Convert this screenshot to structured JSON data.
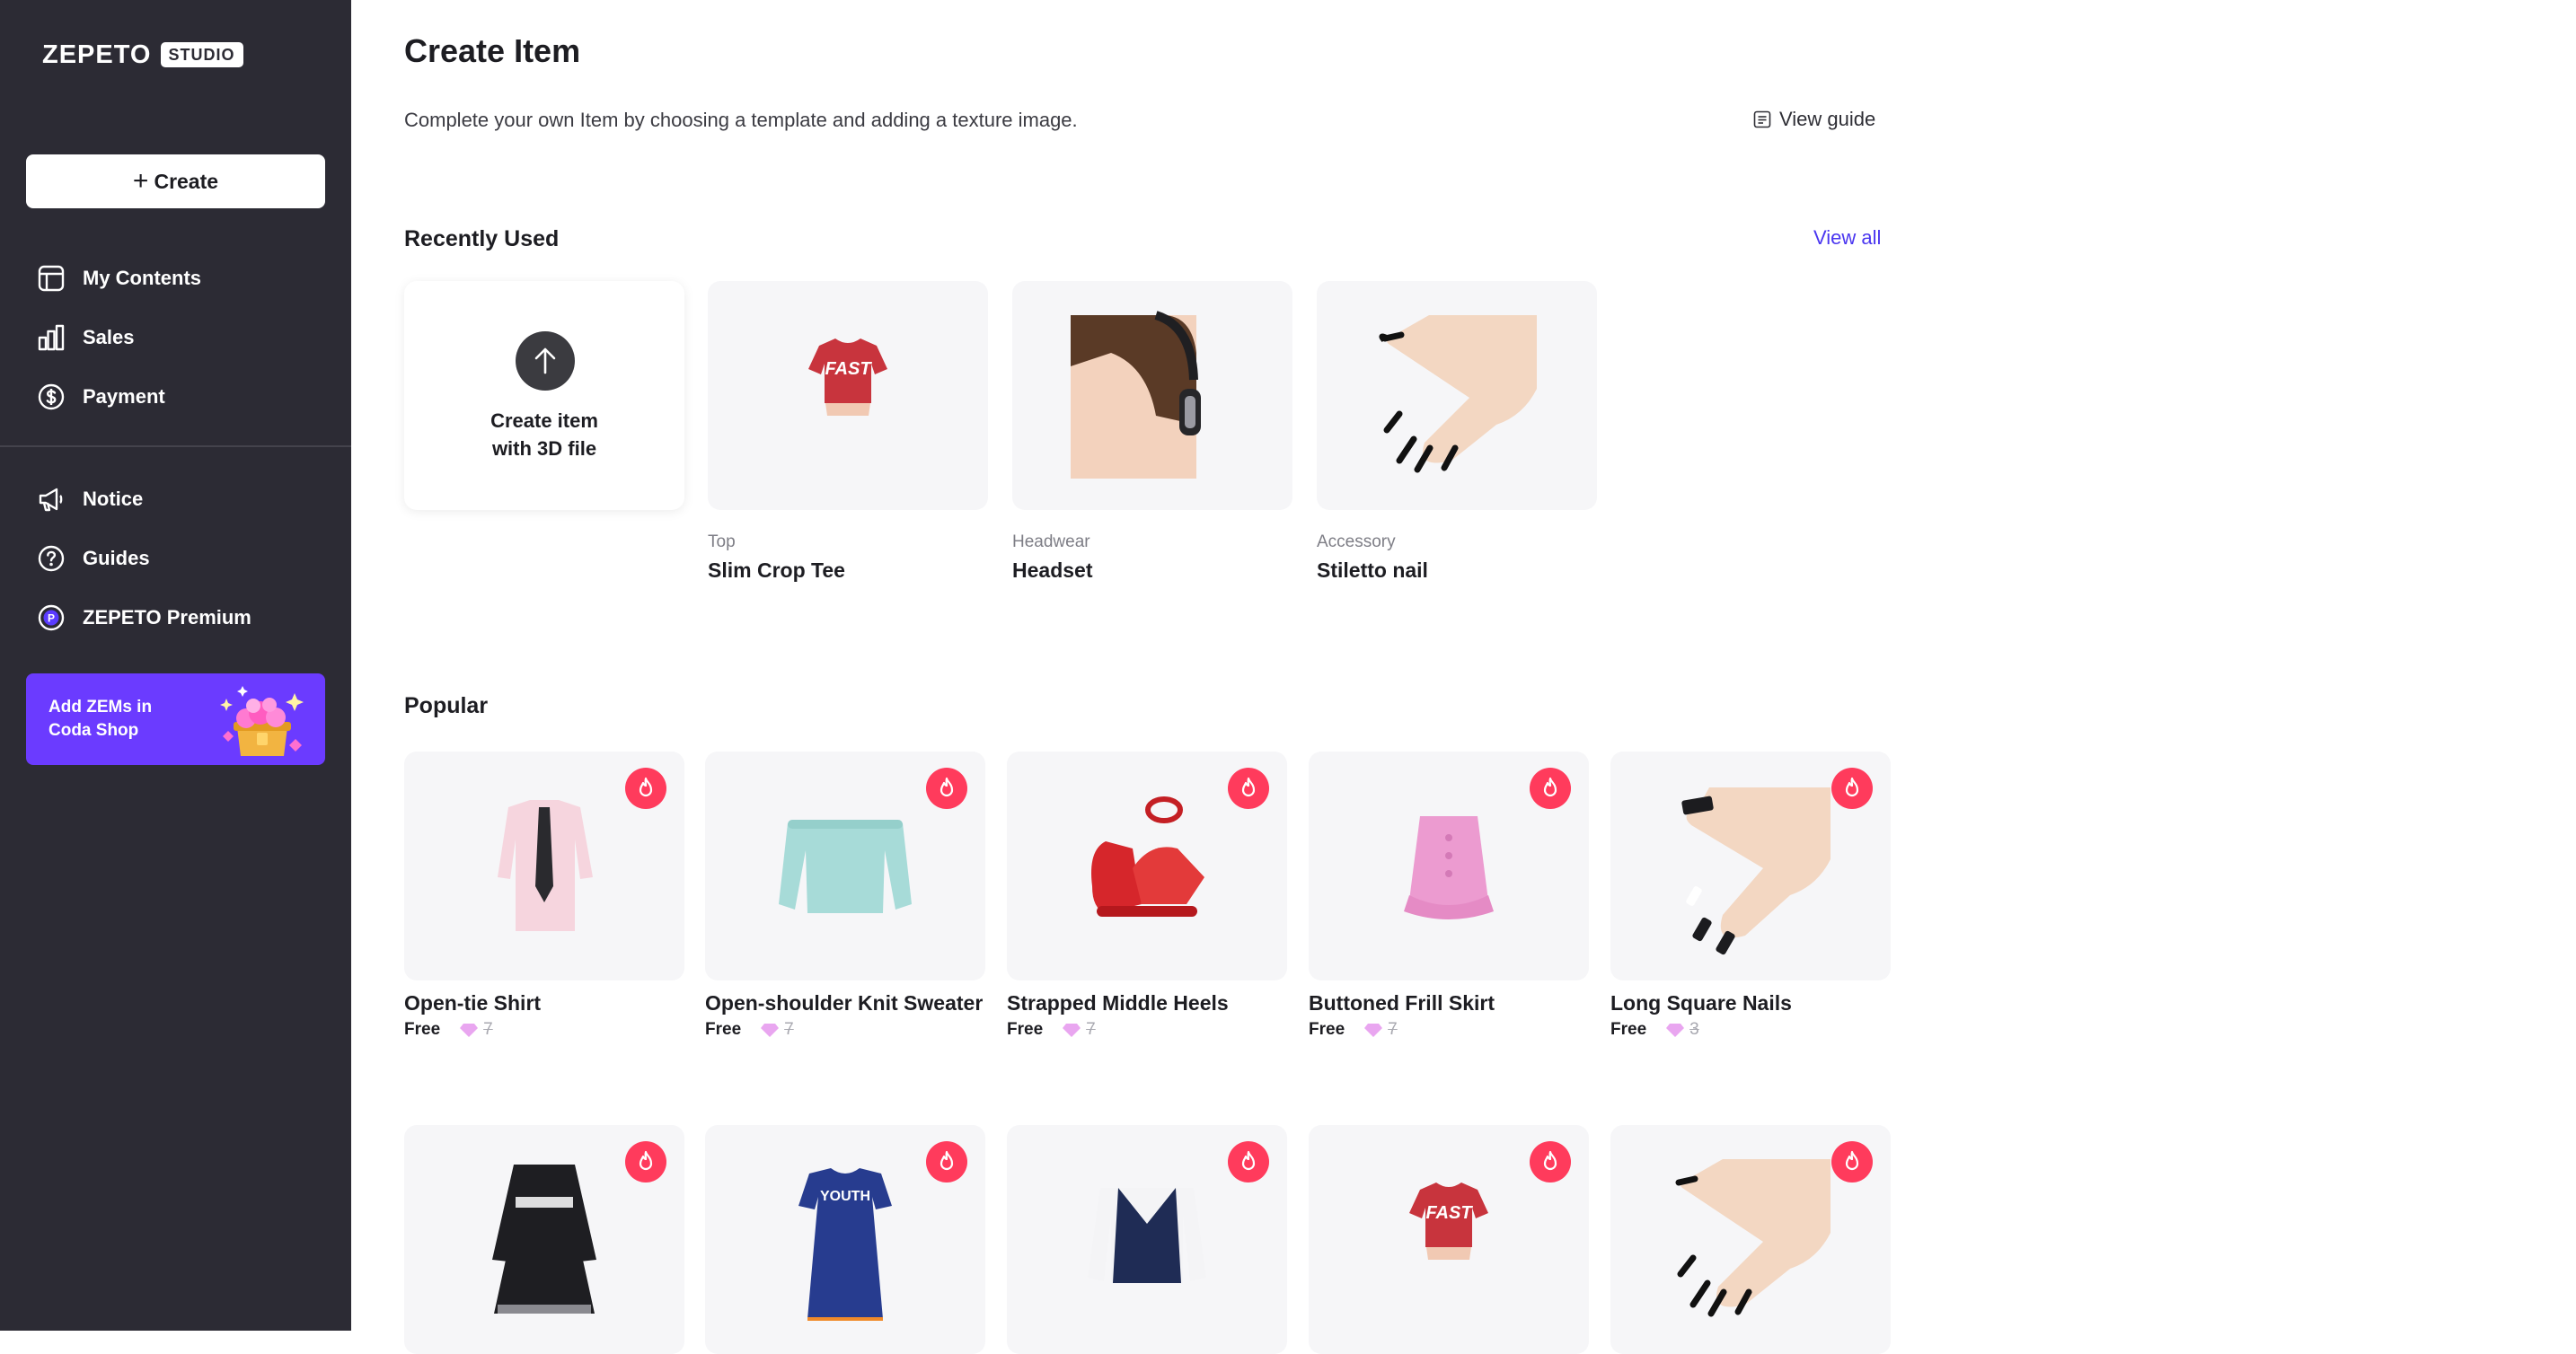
{
  "sidebar": {
    "logo_word": "ZEPETO",
    "logo_badge": "STUDIO",
    "create_label": "Create",
    "nav_primary": [
      {
        "label": "My Contents",
        "icon": "layout-icon"
      },
      {
        "label": "Sales",
        "icon": "bar-chart-icon"
      },
      {
        "label": "Payment",
        "icon": "dollar-circle-icon"
      }
    ],
    "nav_secondary": [
      {
        "label": "Notice",
        "icon": "megaphone-icon"
      },
      {
        "label": "Guides",
        "icon": "question-circle-icon"
      },
      {
        "label": "ZEPETO Premium",
        "icon": "premium-p-icon"
      }
    ],
    "banner_text": "Add ZEMs in Coda Shop"
  },
  "main": {
    "title": "Create Item",
    "subtitle": "Complete your own Item by choosing a template and adding a texture image.",
    "view_guide": "View guide",
    "recent": {
      "title": "Recently Used",
      "view_all": "View all",
      "create_3d_line1": "Create item",
      "create_3d_line2": "with 3D file",
      "items": [
        {
          "category": "Top",
          "name": "Slim Crop Tee"
        },
        {
          "category": "Headwear",
          "name": "Headset"
        },
        {
          "category": "Accessory",
          "name": "Stiletto nail"
        }
      ]
    },
    "popular": {
      "title": "Popular",
      "items": [
        {
          "name": "Open-tie Shirt",
          "price": "Free",
          "original": "7"
        },
        {
          "name": "Open-shoulder Knit Sweater",
          "price": "Free",
          "original": "7"
        },
        {
          "name": "Strapped Middle Heels",
          "price": "Free",
          "original": "7"
        },
        {
          "name": "Buttoned Frill Skirt",
          "price": "Free",
          "original": "7"
        },
        {
          "name": "Long Square Nails",
          "price": "Free",
          "original": "3"
        }
      ]
    }
  },
  "colors": {
    "sidebar": "#2c2b34",
    "accent": "#6b3bff",
    "link": "#4a36f0",
    "hot_badge": "#ff3b5c",
    "card_bg": "#f6f6f8"
  }
}
